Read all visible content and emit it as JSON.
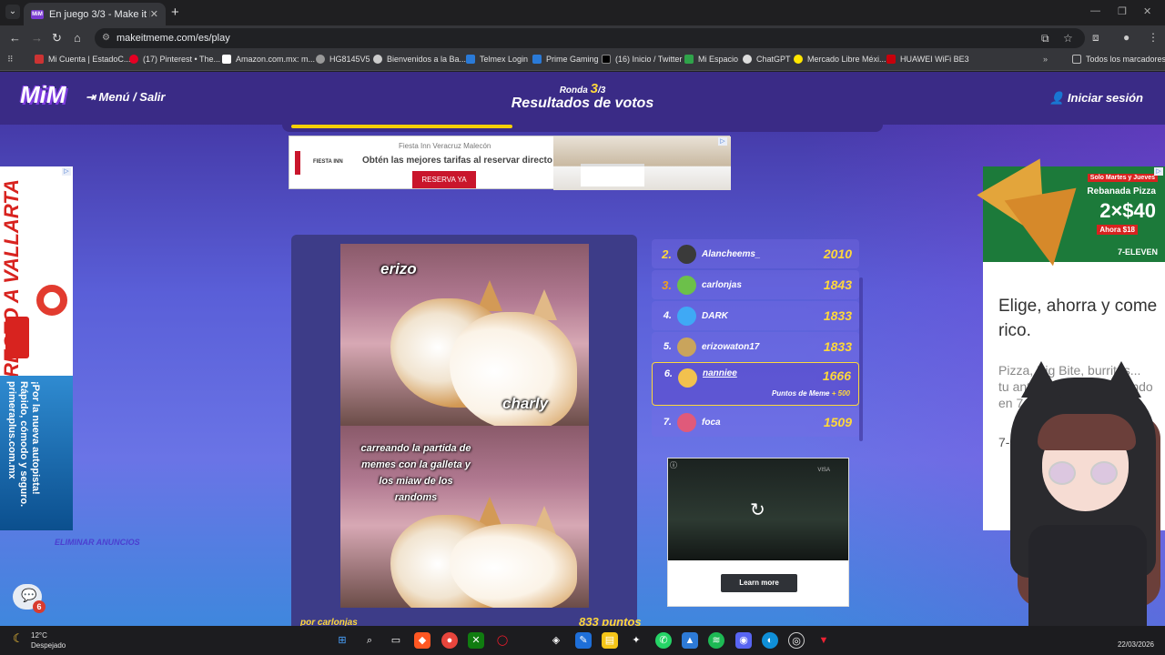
{
  "browser": {
    "tab_title": "En juego 3/3 - Make it Meme",
    "tab_favicon": "MiM",
    "url": "makeitmeme.com/es/play",
    "bookmarks": [
      "Mi Cuenta | EstadoC...",
      "(17) Pinterest • The...",
      "Amazon.com.mx: m...",
      "HG8145V5",
      "Bienvenidos a la Ba...",
      "Telmex Login",
      "Prime Gaming",
      "(16) Inicio / Twitter",
      "Mi Espacio",
      "ChatGPT",
      "Mercado Libre Méxi...",
      "HUAWEI WiFi BE3"
    ],
    "all_bookmarks": "Todos los marcadores"
  },
  "header": {
    "logo": "MiM",
    "menu": "Menú / Salir",
    "round_prefix": "Ronda",
    "round_current": "3",
    "round_total": "/3",
    "title": "Resultados de votos",
    "login": "Iniciar sesión"
  },
  "progress": {
    "fraction": 0.38,
    "color": "#f6d000"
  },
  "top_ad": {
    "brand": "FIESTA INN",
    "hotel": "Fiesta Inn Veracruz Malecón",
    "tagline": "Obtén las mejores tarifas al reservar directo",
    "cta": "RESERVA YA"
  },
  "left_ad": {
    "headline": "Viaja DIRECTO A VALLARTA",
    "body": "¡Por la nueva autopista! Rápido, cómodo y seguro. primeraplus.com.mx"
  },
  "remove_ads": "ELIMINAR ANUNCIOS",
  "chat_badge": "6",
  "meme": {
    "label_top": "erizo",
    "label_mid": "charly",
    "caption": "carreando la partida de memes con la galleta y los miaw de los randoms",
    "author": "por carlonjas",
    "points": "833 puntos"
  },
  "leaderboard": [
    {
      "rank": "2.",
      "name": "Alancheems_",
      "score": "2010",
      "avatar_color": "#3a3a3a",
      "gold": true
    },
    {
      "rank": "3.",
      "name": "carlonjas",
      "score": "1843",
      "avatar_color": "#6cc04a",
      "gold": true
    },
    {
      "rank": "4.",
      "name": "DARK",
      "score": "1833",
      "avatar_color": "#3fa9f5",
      "gold": false
    },
    {
      "rank": "5.",
      "name": "erizowaton17",
      "score": "1833",
      "avatar_color": "#c9a45c",
      "gold": false
    },
    {
      "rank": "6.",
      "name": "nanniee",
      "score": "1666",
      "avatar_color": "#f2c14e",
      "gold": false,
      "me": true,
      "bonus_label": "Puntos de Meme",
      "bonus": "+ 500"
    },
    {
      "rank": "7.",
      "name": "foca",
      "score": "1509",
      "avatar_color": "#e05a7a",
      "gold": false
    }
  ],
  "video_ad": {
    "cta": "Learn more",
    "badge": "VISA"
  },
  "right_ad": {
    "promo": "Solo Martes y Jueves",
    "product": "Rebanada Pizza",
    "price": "2×$40",
    "now": "Ahora $18",
    "brand": "7-ELEVEN",
    "headline": "Elige, ahorra y come rico.",
    "sub": "Pizza, Big Bite, burritos... tu antojo te está esperando en 7-Eleven.",
    "cut": "7-El"
  },
  "taskbar": {
    "temp": "12°C",
    "weather": "Despejado",
    "date": "22/03/2026"
  }
}
